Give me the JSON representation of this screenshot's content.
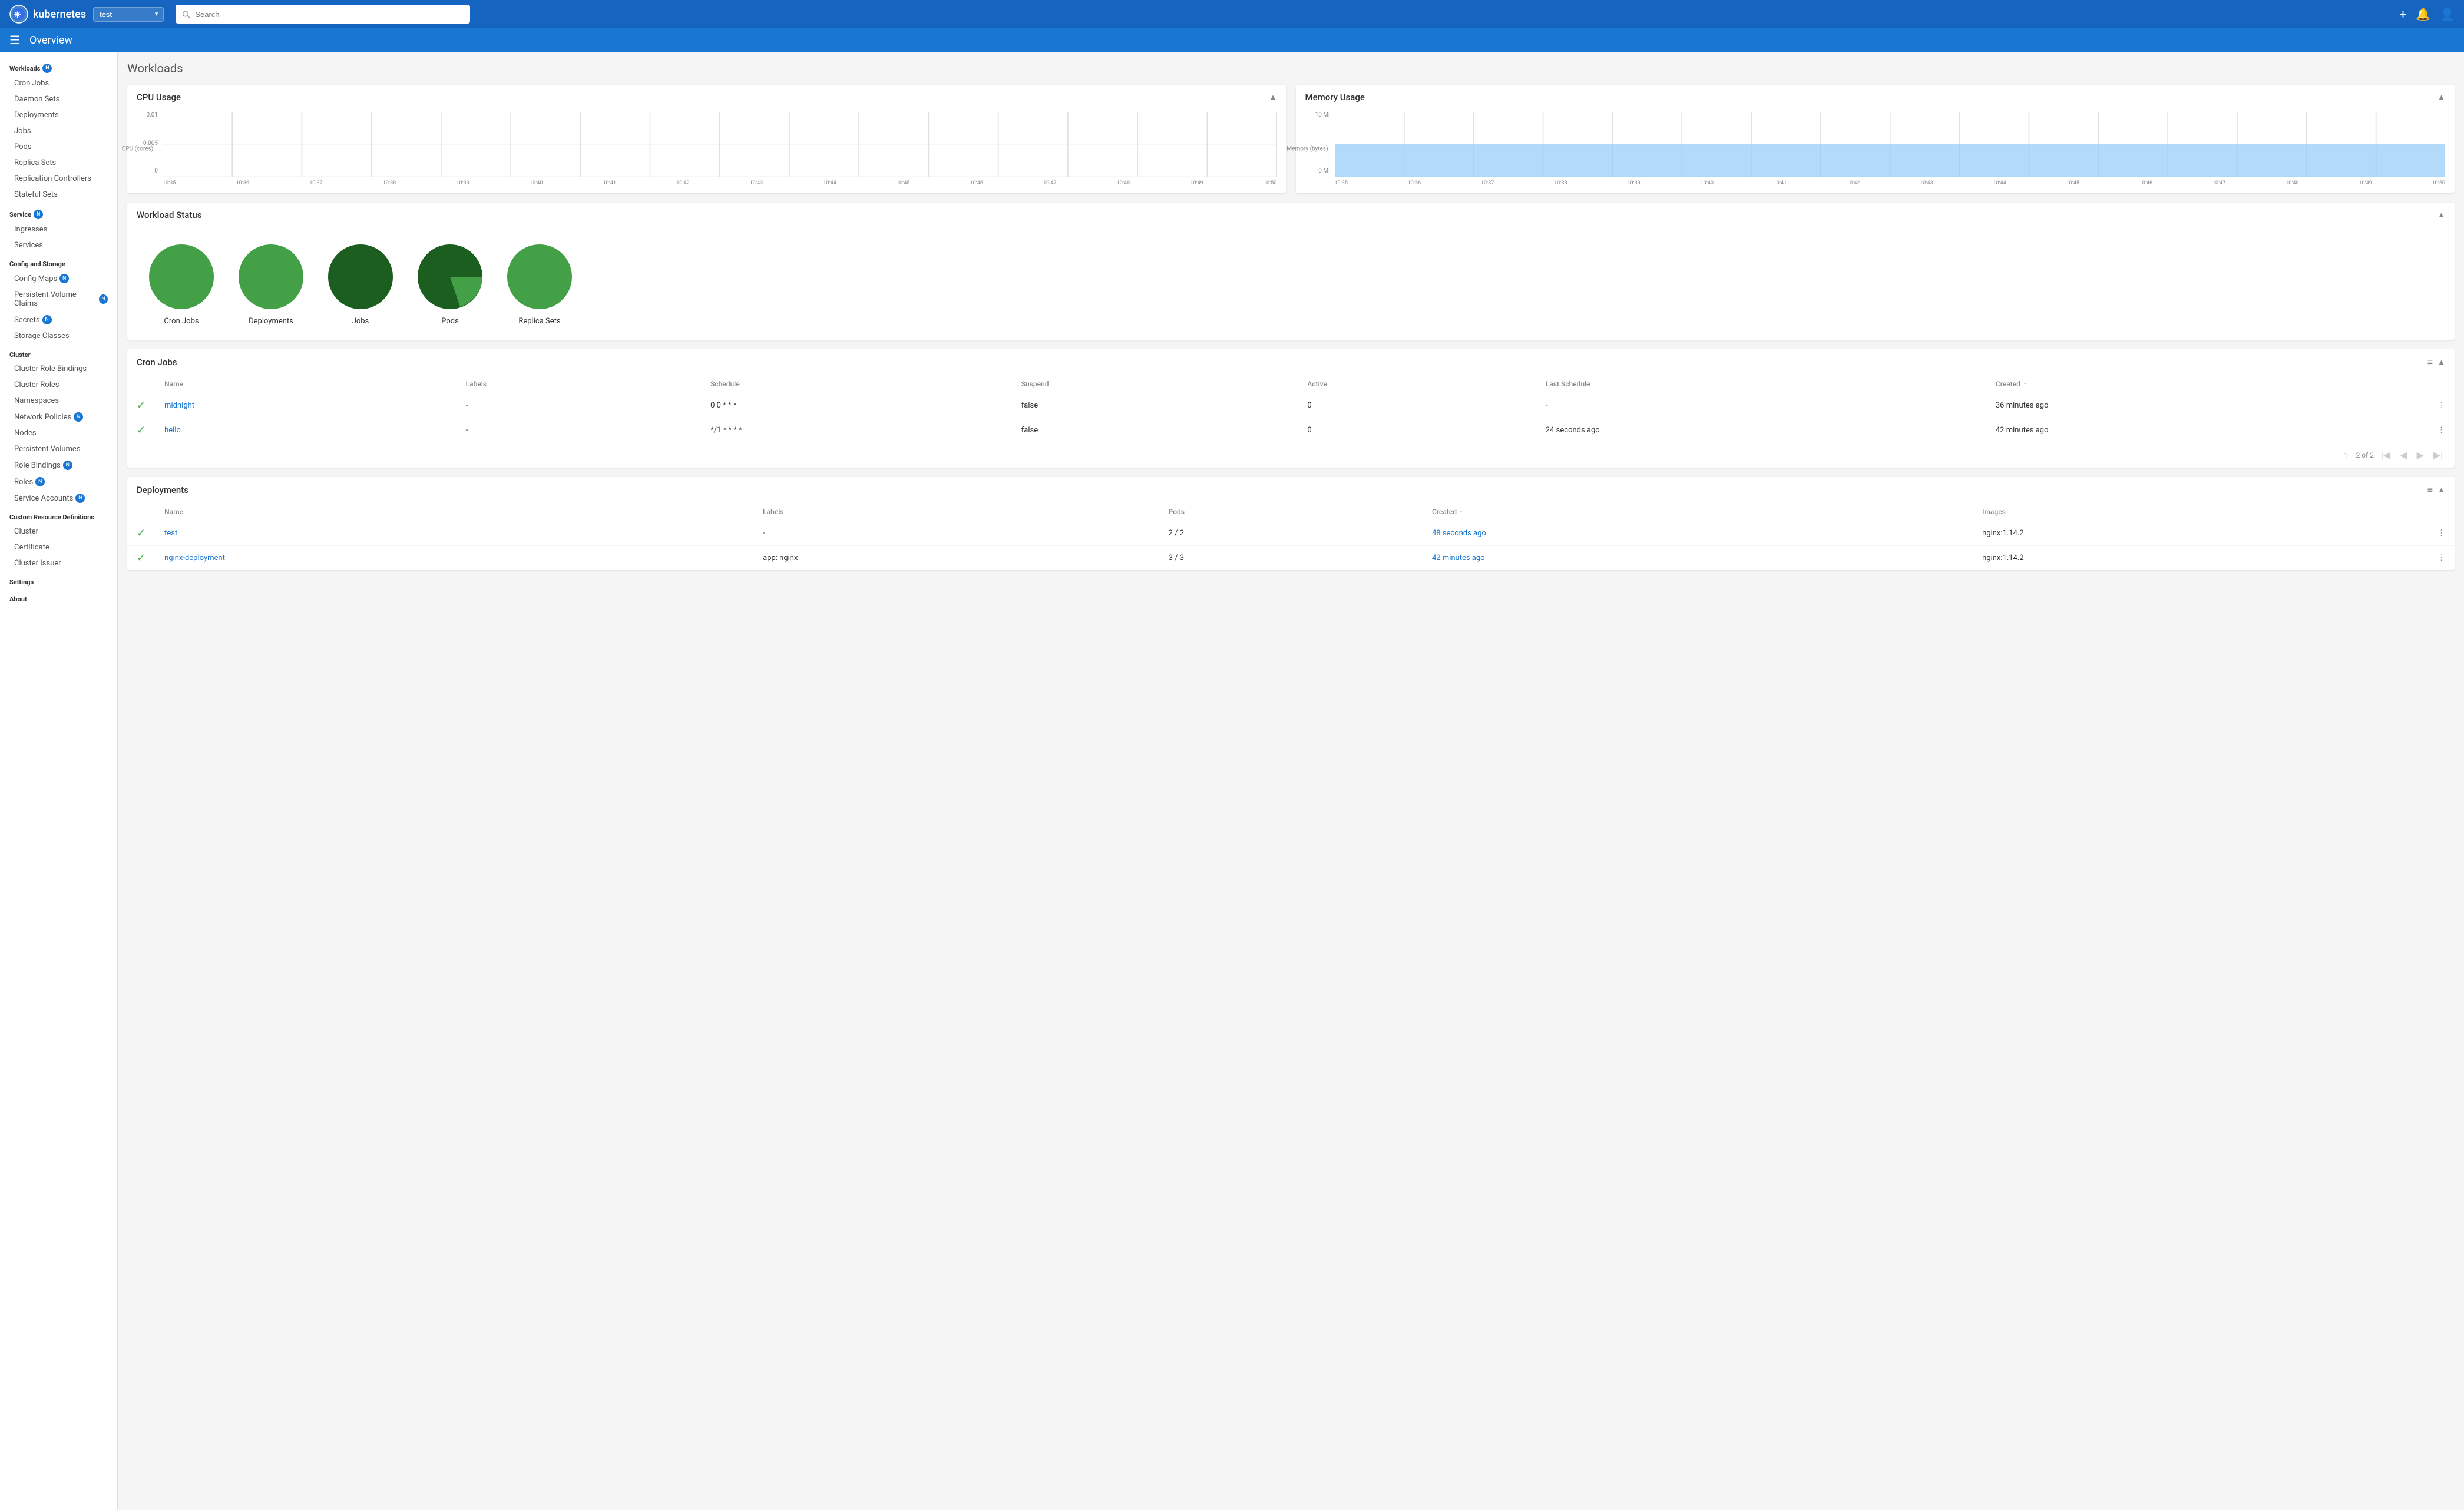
{
  "topbar": {
    "logo_text": "kubernetes",
    "namespace": "test",
    "search_placeholder": "Search",
    "plus_icon": "+",
    "bell_icon": "🔔",
    "user_icon": "👤"
  },
  "navbar": {
    "title": "Overview"
  },
  "sidebar": {
    "workloads_label": "Workloads",
    "workloads_badge": "N",
    "workload_items": [
      "Cron Jobs",
      "Daemon Sets",
      "Deployments",
      "Jobs",
      "Pods",
      "Replica Sets",
      "Replication Controllers",
      "Stateful Sets"
    ],
    "service_label": "Service",
    "service_badge": "N",
    "service_items": [
      "Ingresses",
      "Services"
    ],
    "config_label": "Config and Storage",
    "config_items": [
      "Config Maps",
      "Persistent Volume Claims",
      "Secrets",
      "Storage Classes"
    ],
    "config_badges": {
      "Config Maps": "N",
      "Persistent Volume Claims": "N",
      "Secrets": "N"
    },
    "cluster_label": "Cluster",
    "cluster_items": [
      "Cluster Role Bindings",
      "Cluster Roles",
      "Namespaces",
      "Network Policies",
      "Nodes",
      "Persistent Volumes",
      "Role Bindings",
      "Roles",
      "Service Accounts"
    ],
    "cluster_badges": {
      "Network Policies": "N",
      "Role Bindings": "N",
      "Roles": "N",
      "Service Accounts": "N"
    },
    "crd_label": "Custom Resource Definitions",
    "crd_items": [
      "Cluster",
      "Certificate",
      "Cluster Issuer"
    ],
    "settings_label": "Settings",
    "about_label": "About"
  },
  "page": {
    "title": "Workloads"
  },
  "cpu_chart": {
    "title": "CPU Usage",
    "y_label": "CPU (cores)",
    "y_values": [
      "0.01",
      "0.005",
      "0"
    ],
    "x_labels": [
      "10:35",
      "10:36",
      "10:37",
      "10:38",
      "10:39",
      "10:40",
      "10:41",
      "10:42",
      "10:43",
      "10:44",
      "10:45",
      "10:46",
      "10:47",
      "10:48",
      "10:49",
      "10:50"
    ]
  },
  "memory_chart": {
    "title": "Memory Usage",
    "y_label": "Memory (bytes)",
    "y_values": [
      "10 Mi",
      "0 Mi"
    ],
    "x_labels": [
      "10:35",
      "10:36",
      "10:37",
      "10:38",
      "10:39",
      "10:40",
      "10:41",
      "10:42",
      "10:43",
      "10:44",
      "10:45",
      "10:46",
      "10:47",
      "10:48",
      "10:49",
      "10:50"
    ]
  },
  "workload_status": {
    "title": "Workload Status",
    "items": [
      {
        "label": "Cron Jobs",
        "color": "#43a047",
        "type": "full"
      },
      {
        "label": "Deployments",
        "color": "#43a047",
        "type": "full"
      },
      {
        "label": "Jobs",
        "color": "#1b5e20",
        "type": "full"
      },
      {
        "label": "Pods",
        "color": "#1b5e20",
        "type": "partial",
        "partial_color": "#43a047",
        "partial_pct": 0.8
      },
      {
        "label": "Replica Sets",
        "color": "#43a047",
        "type": "full"
      }
    ]
  },
  "cron_jobs": {
    "title": "Cron Jobs",
    "columns": [
      "",
      "Name",
      "Labels",
      "Schedule",
      "Suspend",
      "Active",
      "Last Schedule",
      "Created"
    ],
    "rows": [
      {
        "name": "midnight",
        "labels": "-",
        "schedule": "0 0 * * *",
        "suspend": "false",
        "active": "0",
        "last_schedule": "-",
        "created": "36 minutes ago"
      },
      {
        "name": "hello",
        "labels": "-",
        "schedule": "*/1 * * * *",
        "suspend": "false",
        "active": "0",
        "last_schedule": "24 seconds ago",
        "created": "42 minutes ago"
      }
    ],
    "pagination": "1 – 2 of 2"
  },
  "deployments": {
    "title": "Deployments",
    "columns": [
      "",
      "Name",
      "Labels",
      "Pods",
      "Created",
      "Images"
    ],
    "rows": [
      {
        "name": "test",
        "labels": "-",
        "pods": "2 / 2",
        "created": "48 seconds ago",
        "images": "nginx:1.14.2"
      },
      {
        "name": "nginx-deployment",
        "labels": "app: nginx",
        "pods": "3 / 3",
        "created": "42 minutes ago",
        "images": "nginx:1.14.2"
      }
    ]
  }
}
